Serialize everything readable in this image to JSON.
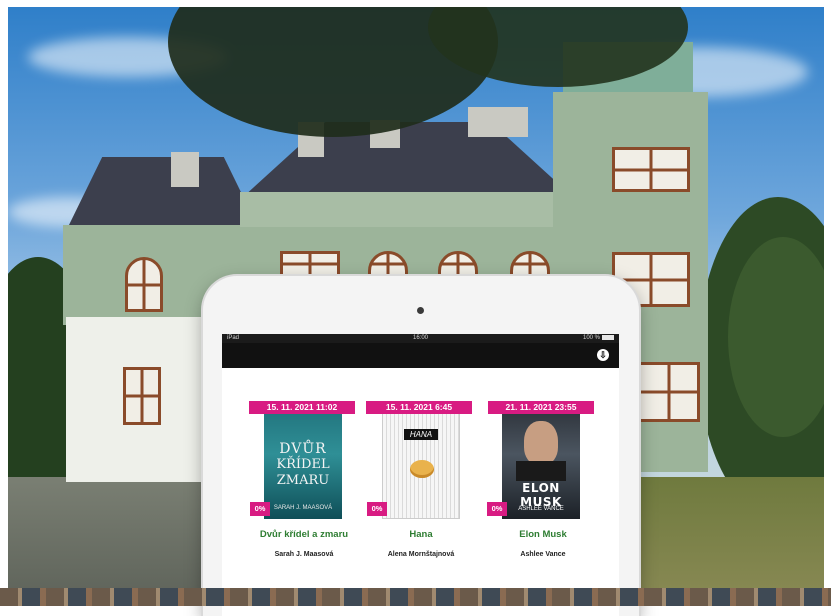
{
  "status_bar": {
    "carrier": "iPad",
    "time": "16:00",
    "battery": "100 %"
  },
  "books": [
    {
      "date": "15. 11. 2021 11:02",
      "percent": "0%",
      "title": "Dvůr křídel a zmaru",
      "author": "Sarah J. Maasová",
      "cover_text_1": "DVŮR",
      "cover_text_2": "KŘÍDEL",
      "cover_text_3": "ZMARU",
      "cover_text_4": "SARAH J. MAASOVÁ"
    },
    {
      "date": "15. 11. 2021 6:45",
      "percent": "0%",
      "title": "Hana",
      "author": "Alena Mornštajnová",
      "cover_text_1": "HANA"
    },
    {
      "date": "21. 11. 2021 23:55",
      "percent": "0%",
      "title": "Elon Musk",
      "author": "Ashlee Vance",
      "cover_text_1": "ELON MUSK",
      "cover_text_2": "ASHLEE VANCE"
    }
  ],
  "colors": {
    "accent": "#d81b82",
    "title_green": "#2e7d32"
  },
  "icons": {
    "nav_button": "download-circle-icon"
  }
}
